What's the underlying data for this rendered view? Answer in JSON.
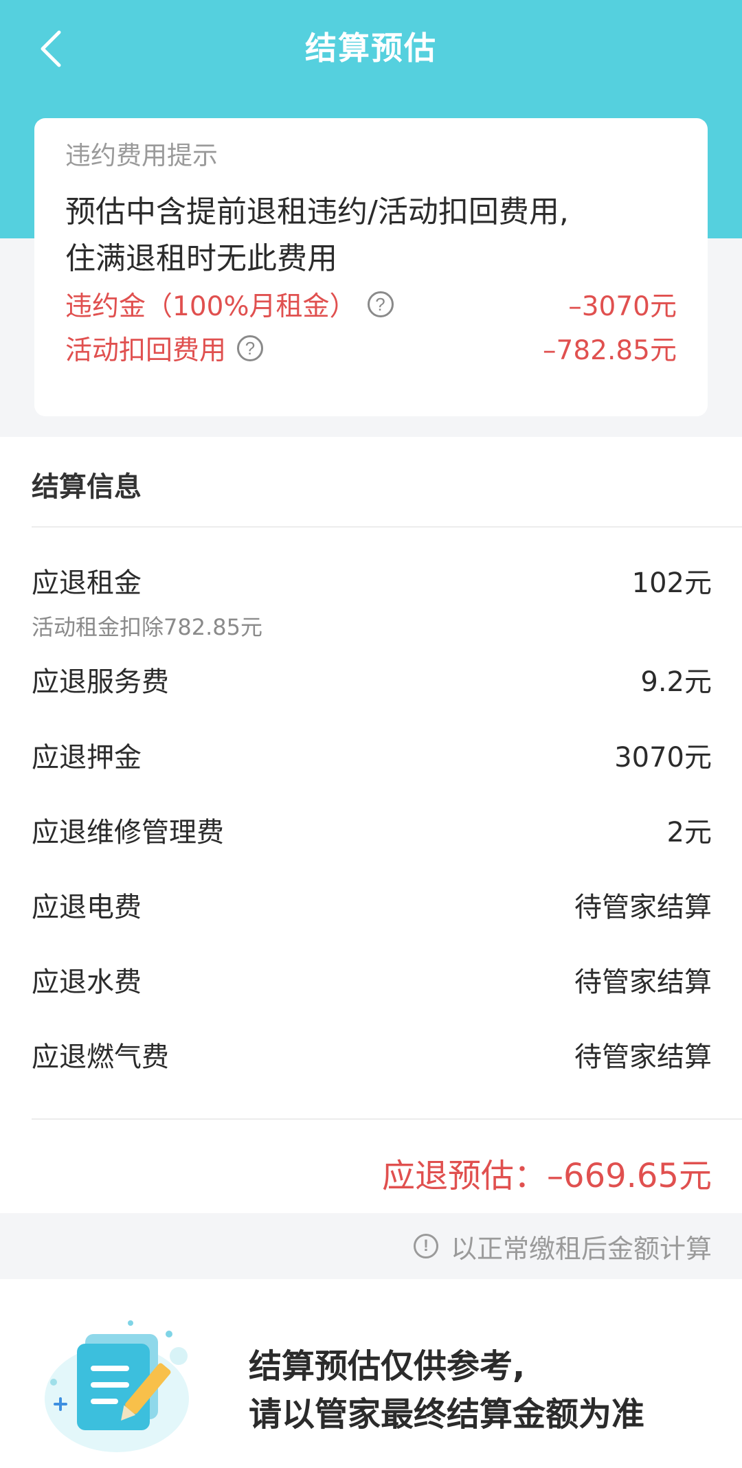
{
  "header": {
    "title": "结算预估"
  },
  "notice": {
    "title": "违约费用提示",
    "body_line1": "预估中含提前退租违约/活动扣回费用,",
    "body_line2": "住满退租时无此费用",
    "items": [
      {
        "label": "违约金（100%月租金）",
        "value": "–3070元"
      },
      {
        "label": "活动扣回费用",
        "value": "–782.85元"
      }
    ]
  },
  "settlement": {
    "title": "结算信息",
    "rows": [
      {
        "label": "应退租金",
        "value": "102元",
        "sub": "活动租金扣除782.85元"
      },
      {
        "label": "应退服务费",
        "value": "9.2元"
      },
      {
        "label": "应退押金",
        "value": "3070元"
      },
      {
        "label": "应退维修管理费",
        "value": "2元"
      },
      {
        "label": "应退电费",
        "value": "待管家结算"
      },
      {
        "label": "应退水费",
        "value": "待管家结算"
      },
      {
        "label": "应退燃气费",
        "value": "待管家结算"
      }
    ],
    "estimate": "应退预估：–669.65元"
  },
  "note": {
    "text": "以正常缴租后金额计算"
  },
  "footer": {
    "line1": "结算预估仅供参考,",
    "line2": "请以管家最终结算金额为准"
  },
  "colors": {
    "header_bg": "#55d0de",
    "accent_red": "#e0504f"
  },
  "icons": {
    "back": "chevron-left-icon",
    "help": "question-circle-icon",
    "info": "info-circle-icon",
    "illustration": "document-edit-illustration"
  }
}
